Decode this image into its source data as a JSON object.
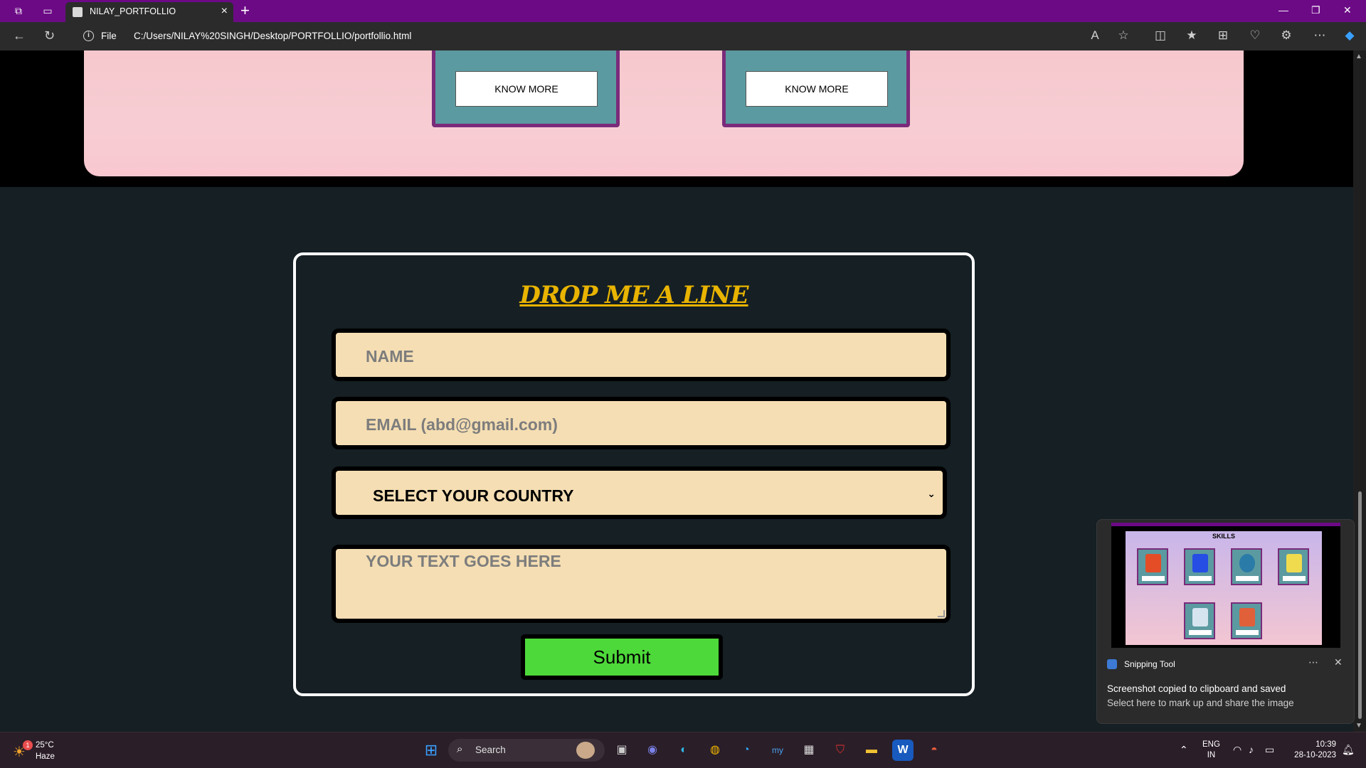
{
  "browser": {
    "tab_title": "NILAY_PORTFOLLIO",
    "address_scheme": "File",
    "address_url": "C:/Users/NILAY%20SINGH/Desktop/PORTFOLLIO/portfollio.html"
  },
  "skills_section": {
    "cards": [
      {
        "button_label": "KNOW MORE"
      },
      {
        "button_label": "KNOW MORE"
      }
    ]
  },
  "contact_form": {
    "title": "DROP ME A LINE",
    "name_placeholder": "NAME",
    "email_placeholder": "EMAIL (abd@gmail.com)",
    "country_selected": "SELECT YOUR COUNTRY",
    "message_placeholder": "YOUR TEXT GOES HERE",
    "submit_label": "Submit"
  },
  "notification": {
    "app_name": "Snipping Tool",
    "message_title": "Screenshot copied to clipboard and saved",
    "message_body": "Select here to mark up and share the image",
    "preview_title": "SKILLS"
  },
  "taskbar": {
    "weather_temp": "25°C",
    "weather_condition": "Haze",
    "weather_badge": "1",
    "search_label": "Search",
    "lang_top": "ENG",
    "lang_bottom": "IN",
    "time": "10:39",
    "date": "28-10-2023"
  },
  "colors": {
    "tabbar": "#6c0a86",
    "page_dark": "#151f24",
    "pink_panel": "#f7cdd3",
    "card": "#5b9aa0",
    "card_border": "#7a2b7a",
    "title_gold": "#e9b400",
    "field_bg": "#f5deb3",
    "submit_green": "#4ed93a"
  }
}
